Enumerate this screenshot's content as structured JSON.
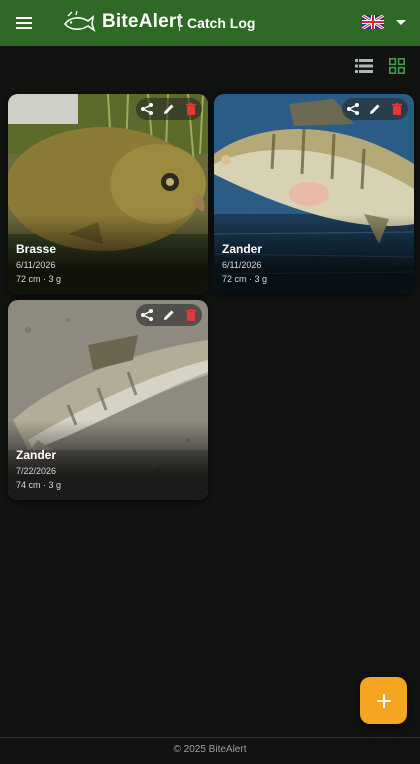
{
  "header": {
    "brand": "BiteAlert",
    "section": "Catch Log",
    "language": "UK flag"
  },
  "view_toggle": {
    "list_icon": "list-view-icon",
    "grid_icon": "grid-view-icon",
    "active": "grid"
  },
  "catches": [
    {
      "name": "Brasse",
      "date": "6/11/2026",
      "meta": "72 cm · 3 g"
    },
    {
      "name": "Zander",
      "date": "6/11/2026",
      "meta": "72 cm · 3 g"
    },
    {
      "name": "Zander",
      "date": "7/22/2026",
      "meta": "74 cm · 3 g"
    }
  ],
  "card_actions": [
    "share-icon",
    "edit-icon",
    "delete-icon"
  ],
  "fab": {
    "label": "+"
  },
  "footer": {
    "text": "© 2025 BiteAlert"
  },
  "colors": {
    "appbar": "#2e6a26",
    "background": "#111310",
    "fab": "#f5a522",
    "delete": "#e53935",
    "grid_active": "#43a047"
  }
}
